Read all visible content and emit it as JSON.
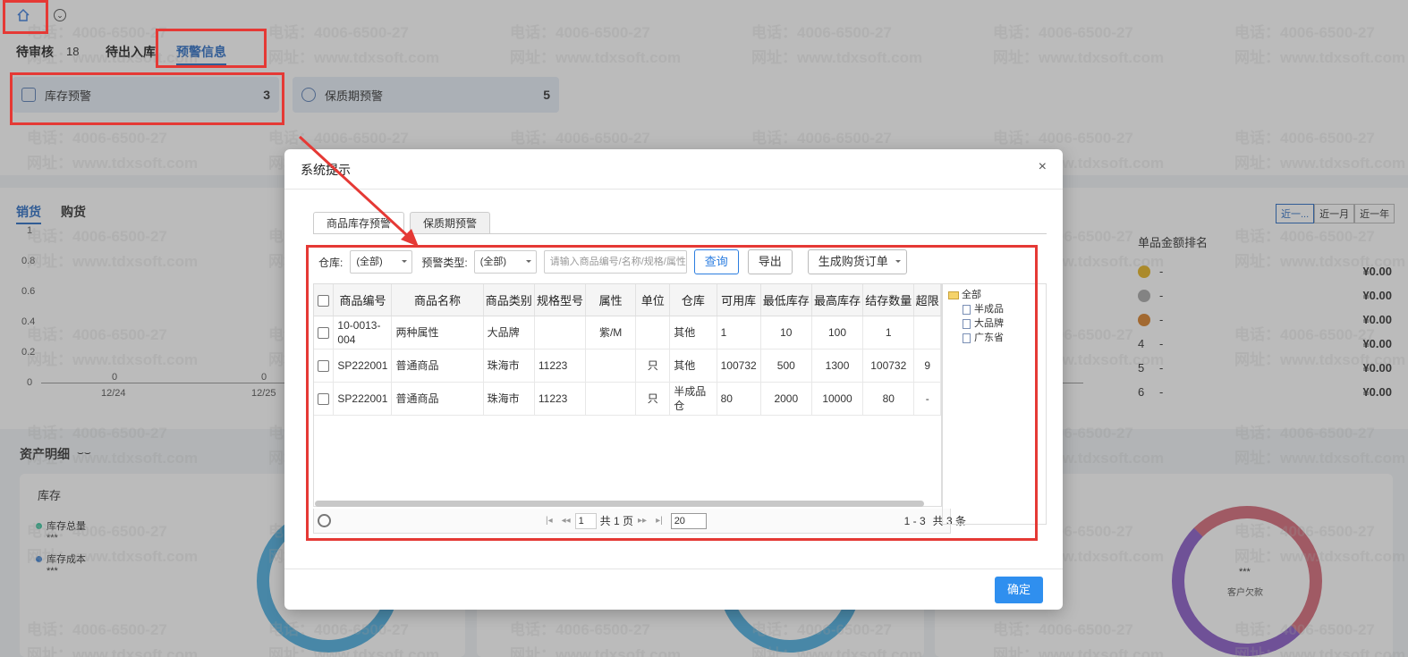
{
  "nav": {
    "home_icon": "home-icon",
    "dropdown_icon": "chevron-down-icon"
  },
  "top_tabs": [
    {
      "label": "待审核",
      "count": "18"
    },
    {
      "label": "待出入库"
    },
    {
      "label": "预警信息"
    }
  ],
  "alerts": [
    {
      "label": "库存预警",
      "count": "3"
    },
    {
      "label": "保质期预警",
      "count": "5"
    }
  ],
  "sales": {
    "tabs": [
      "销货",
      "购货"
    ],
    "y_ticks": [
      "1",
      "0.8",
      "0.6",
      "0.4",
      "0.2",
      "0"
    ],
    "x_ticks": [
      "12/24",
      "12/25"
    ],
    "point_labels": [
      "0",
      "0"
    ],
    "range_buttons": [
      "近一...",
      "近一月",
      "近一年"
    ],
    "rank_title": "单品金额排名",
    "rank_rows": [
      {
        "rank": "",
        "name": "-",
        "amount": "¥0.00"
      },
      {
        "rank": "",
        "name": "-",
        "amount": "¥0.00"
      },
      {
        "rank": "",
        "name": "-",
        "amount": "¥0.00"
      },
      {
        "rank": "4",
        "name": "-",
        "amount": "¥0.00"
      },
      {
        "rank": "5",
        "name": "-",
        "amount": "¥0.00"
      },
      {
        "rank": "6",
        "name": "-",
        "amount": "¥0.00"
      }
    ]
  },
  "assets": {
    "title": "资产明细",
    "card1_title": "库存",
    "legend": [
      {
        "label": "库存总量",
        "value": "***"
      },
      {
        "label": "库存成本",
        "value": "***"
      }
    ],
    "donut_value": "***",
    "donut_label": "客户欠款"
  },
  "watermark": {
    "phone": "电话：4006-6500-27",
    "site": "网址：www.tdxsoft.com"
  },
  "modal": {
    "title": "系统提示",
    "close": "×",
    "tabs": [
      "商品库存预警",
      "保质期预警"
    ],
    "filter": {
      "warehouse_label": "仓库:",
      "warehouse_value": "(全部)",
      "type_label": "预警类型:",
      "type_value": "(全部)",
      "search_placeholder": "请输入商品编号/名称/规格/属性",
      "query_btn": "查询",
      "export_btn": "导出",
      "generate_btn": "生成购货订单"
    },
    "columns": [
      "商品编号",
      "商品名称",
      "商品类别",
      "规格型号",
      "属性",
      "单位",
      "仓库",
      "可用库",
      "最低库存",
      "最高库存",
      "结存数量",
      "超限"
    ],
    "rows": [
      [
        "10-0013-004",
        "两种属性",
        "大品牌",
        "",
        "紫/M",
        "",
        "其他",
        "1",
        "10",
        "100",
        "1",
        ""
      ],
      [
        "SP222001",
        "普通商品",
        "珠海市",
        "11223",
        "",
        "只",
        "其他",
        "100732",
        "500",
        "1300",
        "100732",
        "9"
      ],
      [
        "SP222001",
        "普通商品",
        "珠海市",
        "11223",
        "",
        "只",
        "半成品仓",
        "80",
        "2000",
        "10000",
        "80",
        "-"
      ]
    ],
    "pager": {
      "page": "1",
      "total_pages": "共 1 页",
      "page_size": "20",
      "range": "1 - 3",
      "total": "共 3 条"
    },
    "tree": {
      "root": "全部",
      "children": [
        "半成品",
        "大品牌",
        "广东省"
      ]
    },
    "ok_btn": "确定"
  },
  "colors": {
    "accent": "#2b6ec5",
    "ok": "#2f8fef",
    "highlight": "#e53935"
  }
}
